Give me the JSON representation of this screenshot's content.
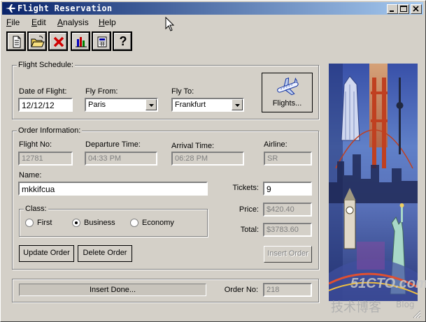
{
  "window": {
    "title": "Flight Reservation",
    "buttons": [
      "minimize",
      "maximize",
      "close"
    ]
  },
  "menu": [
    {
      "label": "File",
      "accel": "F"
    },
    {
      "label": "Edit",
      "accel": "E"
    },
    {
      "label": "Analysis",
      "accel": "A"
    },
    {
      "label": "Help",
      "accel": "H"
    }
  ],
  "toolbar": {
    "new_icon": "new-document-icon",
    "open_icon": "open-folder-icon",
    "delete_icon": "delete-x-icon",
    "graph_icon": "bar-chart-icon",
    "calc_icon": "calculator-icon",
    "help_label": "?"
  },
  "schedule": {
    "legend": "Flight Schedule:",
    "date_label": "Date of Flight:",
    "date_value": "12/12/12",
    "from_label": "Fly From:",
    "from_value": "Paris",
    "to_label": "Fly To:",
    "to_value": "Frankfurt",
    "flights_label": "Flights..."
  },
  "order": {
    "legend": "Order Information:",
    "flight_no_label": "Flight No:",
    "flight_no_value": "12781",
    "departure_label": "Departure Time:",
    "departure_value": "04:33 PM",
    "arrival_label": "Arrival Time:",
    "arrival_value": "06:28 PM",
    "airline_label": "Airline:",
    "airline_value": "SR",
    "name_label": "Name:",
    "name_value": "mkkifcua",
    "tickets_label": "Tickets:",
    "tickets_value": "9",
    "price_label": "Price:",
    "price_value": "$420.40",
    "total_label": "Total:",
    "total_value": "$3783.60",
    "class_legend": "Class:",
    "class_first": "First",
    "class_business": "Business",
    "class_economy": "Economy",
    "class_selected": "Business",
    "update_label": "Update Order",
    "delete_label": "Delete Order",
    "insert_label": "Insert Order"
  },
  "status": {
    "message": "Insert Done...",
    "order_no_label": "Order No:",
    "order_no_value": "218"
  },
  "watermark": {
    "site": "51CTO.com",
    "blog": "技术博客",
    "blog_en": "Blog"
  },
  "colors": {
    "face": "#d4d0c8",
    "title_start": "#0a246a",
    "title_end": "#a6caf0"
  }
}
